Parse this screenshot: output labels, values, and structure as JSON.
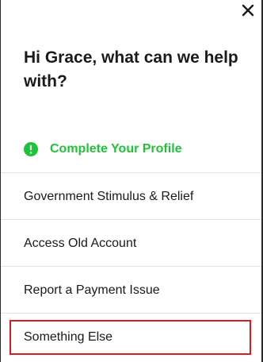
{
  "dialog": {
    "close_icon": "close-icon",
    "heading": "Hi Grace, what can we help with?"
  },
  "profile": {
    "icon": "alert-circle-icon",
    "label": "Complete Your Profile",
    "accent_color": "#1fc337"
  },
  "menu": {
    "items": [
      {
        "label": "Government Stimulus & Relief"
      },
      {
        "label": "Access Old Account"
      },
      {
        "label": "Report a Payment Issue"
      },
      {
        "label": "Something Else"
      }
    ]
  },
  "highlight": {
    "target": "Something Else",
    "color": "#d81d1d"
  }
}
